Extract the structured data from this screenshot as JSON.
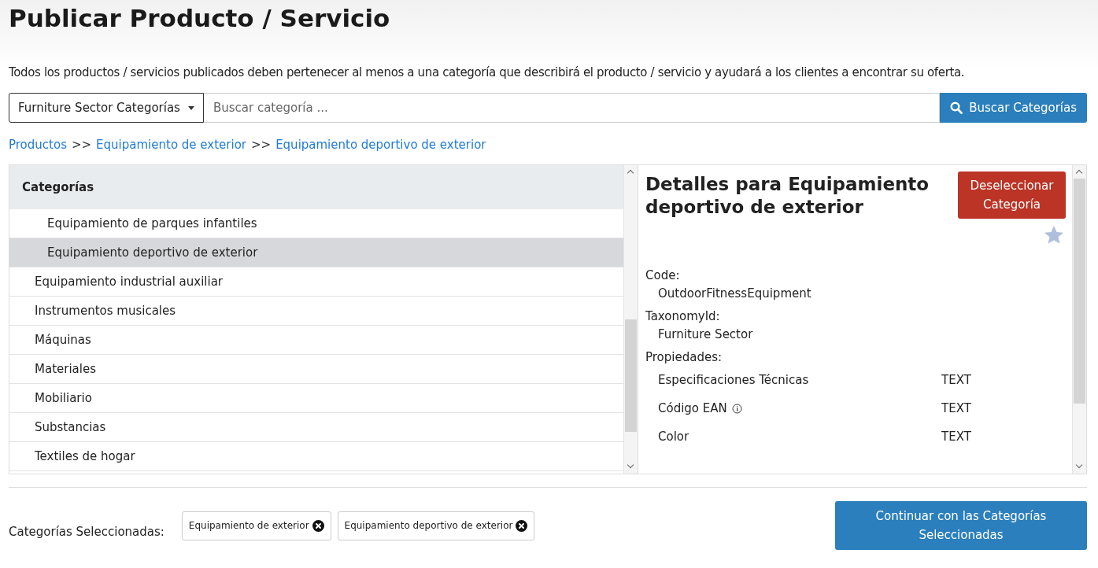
{
  "page": {
    "title": "Publicar Producto / Servicio",
    "intro": "Todos los productos / servicios publicados deben pertenecer al menos a una categoría que describirá el producto / servicio y ayudará a los clientes a encontrar su oferta."
  },
  "search": {
    "taxonomy": "Furniture Sector Categorías",
    "placeholder": "Buscar categoría ...",
    "button": "Buscar Categorías"
  },
  "breadcrumb": [
    {
      "kind": "link",
      "text": "Productos"
    },
    {
      "kind": "sep",
      "text": ">>"
    },
    {
      "kind": "link",
      "text": "Equipamiento de exterior"
    },
    {
      "kind": "sep",
      "text": ">>"
    },
    {
      "kind": "link",
      "text": "Equipamiento deportivo de exterior"
    }
  ],
  "categories": {
    "header": "Categorías",
    "items": [
      {
        "children": [
          {
            "label": "Equipamiento de parques infantiles",
            "selected": false
          },
          {
            "label": "Equipamiento deportivo de exterior",
            "selected": true
          }
        ]
      },
      {
        "label": "Equipamiento industrial auxiliar",
        "selected": false
      },
      {
        "label": "Instrumentos musicales",
        "selected": false
      },
      {
        "label": "Máquinas",
        "selected": false
      },
      {
        "label": "Materiales",
        "selected": false
      },
      {
        "label": "Mobiliario",
        "selected": false
      },
      {
        "label": "Substancias",
        "selected": false
      },
      {
        "label": "Textiles de hogar",
        "selected": false
      }
    ]
  },
  "details": {
    "title": "Detalles para Equipamiento deportivo de exterior",
    "deselect_button": "Deseleccionar Categoría",
    "favorite": false,
    "fields": [
      {
        "label": "Code:",
        "value": "OutdoorFitnessEquipment"
      },
      {
        "label": "TaxonomyId:",
        "value": "Furniture Sector"
      }
    ],
    "properties_label": "Propiedades:",
    "properties": [
      {
        "name": "Especificaciones Técnicas",
        "type": "TEXT",
        "info": false
      },
      {
        "name": "Código EAN",
        "type": "TEXT",
        "info": true
      },
      {
        "name": "Color",
        "type": "TEXT",
        "info": false
      }
    ]
  },
  "footer": {
    "label": "Categorías Seleccionadas:",
    "chips": [
      "Equipamiento de exterior",
      "Equipamiento deportivo de exterior"
    ],
    "continue_button": "Continuar con las Categorías Seleccionadas"
  }
}
